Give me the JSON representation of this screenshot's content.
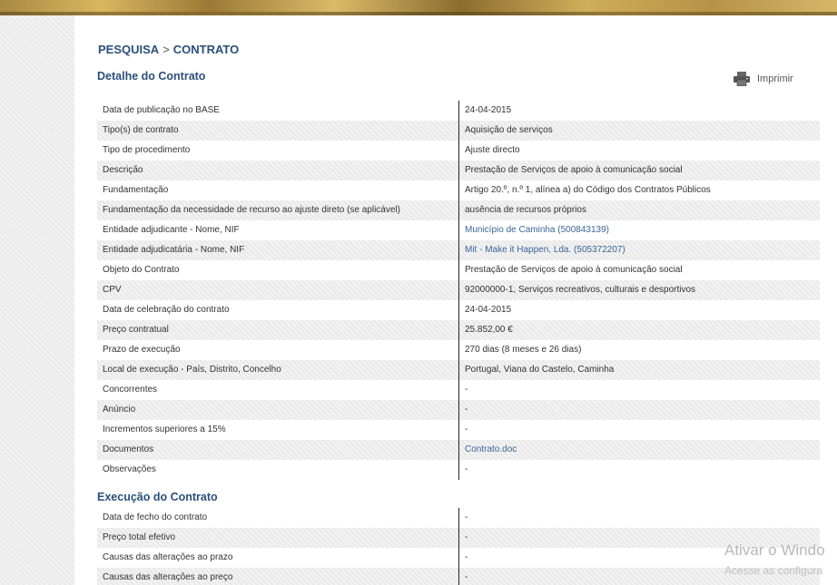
{
  "breadcrumb": {
    "root": "PESQUISA",
    "separator": ">",
    "current": "CONTRATO"
  },
  "detail": {
    "title": "Detalhe do Contrato",
    "print_label": "Imprimir",
    "rows": [
      {
        "label": "Data de publicação no BASE",
        "value": "24-04-2015"
      },
      {
        "label": "Tipo(s) de contrato",
        "value": "Aquisição de serviços"
      },
      {
        "label": "Tipo de procedimento",
        "value": "Ajuste directo"
      },
      {
        "label": "Descrição",
        "value": "Prestação de Serviços de apoio à comunicação social"
      },
      {
        "label": "Fundamentação",
        "value": "Artigo 20.º, n.º 1, alínea a) do Código dos Contratos Públicos"
      },
      {
        "label": "Fundamentação da necessidade de recurso ao ajuste direto (se aplicável)",
        "value": "ausência de recursos próprios"
      },
      {
        "label": "Entidade adjudicante - Nome, NIF",
        "value": "Município de Caminha (500843139)"
      },
      {
        "label": "Entidade adjudicatária - Nome, NIF",
        "value": "Mit - Make it Happen, Lda. (505372207)"
      },
      {
        "label": "Objeto do Contrato",
        "value": "Prestação de Serviços de apoio à comunicação social"
      },
      {
        "label": "CPV",
        "value": "92000000-1, Serviços recreativos, culturais e desportivos"
      },
      {
        "label": "Data de celebração do contrato",
        "value": "24-04-2015"
      },
      {
        "label": "Preço contratual",
        "value": "25.852,00 €"
      },
      {
        "label": "Prazo de execução",
        "value": "270 dias (8 meses e 26 dias)"
      },
      {
        "label": "Local de execução - País, Distrito, Concelho",
        "value": "Portugal, Viana do Castelo, Caminha"
      },
      {
        "label": "Concorrentes",
        "value": "-"
      },
      {
        "label": "Anúncio",
        "value": "-"
      },
      {
        "label": "Incrementos superiores a 15%",
        "value": "-"
      },
      {
        "label": "Documentos",
        "value": "Contrato.doc"
      },
      {
        "label": "Observações",
        "value": "-"
      }
    ]
  },
  "execution": {
    "title": "Execução do Contrato",
    "rows": [
      {
        "label": "Data de fecho do contrato",
        "value": "-"
      },
      {
        "label": "Preço total efetivo",
        "value": "-"
      },
      {
        "label": "Causas das alterações ao prazo",
        "value": "-"
      },
      {
        "label": "Causas das alterações ao preço",
        "value": "-"
      }
    ]
  },
  "watermark": {
    "line1": "Ativar o Windo",
    "line2": "Acesse as configura"
  },
  "icons": {
    "print": "printer-icon"
  }
}
